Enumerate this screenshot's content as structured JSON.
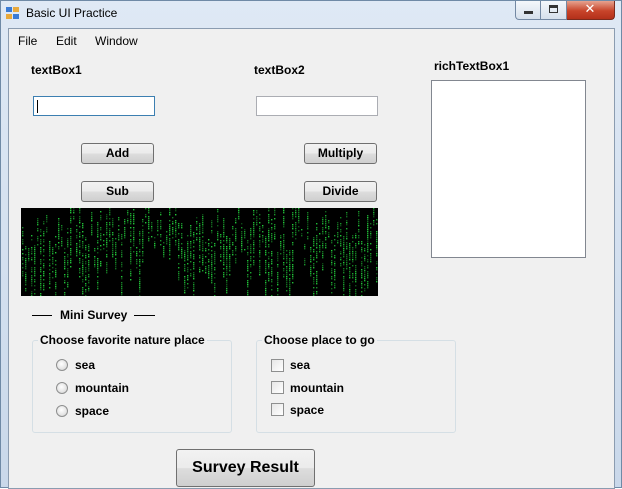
{
  "window": {
    "title": "Basic UI Practice",
    "close_glyph": "✕"
  },
  "menu": {
    "items": [
      {
        "label": "File"
      },
      {
        "label": "Edit"
      },
      {
        "label": "Window"
      }
    ]
  },
  "form": {
    "textbox1_label": "textBox1",
    "textbox2_label": "textBox2",
    "richtextbox_label": "richTextBox1",
    "textbox1_value": "",
    "textbox2_value": "",
    "buttons": {
      "add": "Add",
      "multiply": "Multiply",
      "sub": "Sub",
      "divide": "Divide"
    }
  },
  "survey": {
    "title": "Mini Survey",
    "group1": {
      "title": "Choose favorite nature place",
      "options": [
        "sea",
        "mountain",
        "space"
      ]
    },
    "group2": {
      "title": "Choose place to go",
      "options": [
        "sea",
        "mountain",
        "space"
      ]
    },
    "result_button": "Survey Result"
  },
  "colors": {
    "matrix_green": "#22c93a",
    "close_red": "#c8442a"
  },
  "icons": {
    "app": "app-icon",
    "minimize": "minimize-icon",
    "maximize": "maximize-icon",
    "close": "close-icon",
    "image": "matrix-rain-image"
  }
}
